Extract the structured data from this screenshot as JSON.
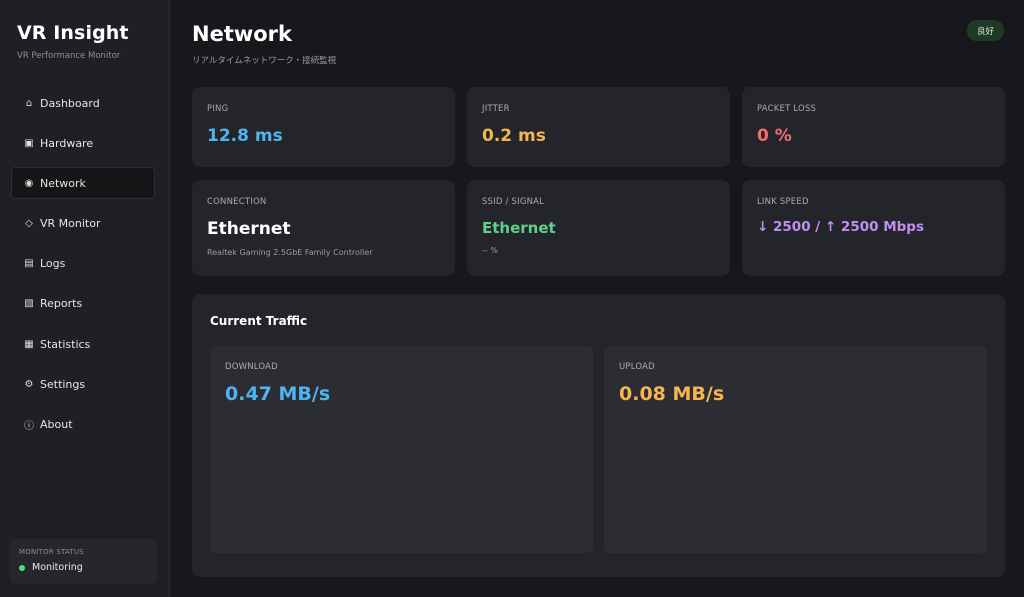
{
  "sidebar": {
    "brand_title": "VR Insight",
    "brand_subtitle": "VR Performance Monitor",
    "items": [
      {
        "label": "Dashboard",
        "icon": "⌂",
        "icon_name": "home-icon"
      },
      {
        "label": "Hardware",
        "icon": "▣",
        "icon_name": "chip-icon"
      },
      {
        "label": "Network",
        "icon": "◉",
        "icon_name": "network-icon",
        "active": true
      },
      {
        "label": "VR Monitor",
        "icon": "◇",
        "icon_name": "vr-icon"
      },
      {
        "label": "Logs",
        "icon": "▤",
        "icon_name": "logs-icon"
      },
      {
        "label": "Reports",
        "icon": "▧",
        "icon_name": "reports-icon"
      },
      {
        "label": "Statistics",
        "icon": "▦",
        "icon_name": "statistics-icon"
      },
      {
        "label": "Settings",
        "icon": "⚙",
        "icon_name": "gear-icon"
      },
      {
        "label": "About",
        "icon": "ⓘ",
        "icon_name": "info-icon"
      }
    ],
    "monitor_status": {
      "label": "MONITOR STATUS",
      "value": "Monitoring",
      "dot_color": "#4ade80"
    }
  },
  "header": {
    "title": "Network",
    "subtitle": "リアルタイムネットワーク・接続監視",
    "status_badge": "良好"
  },
  "metrics": {
    "ping": {
      "label": "PING",
      "value": "12.8 ms",
      "color": "#4fb4f0"
    },
    "jitter": {
      "label": "JITTER",
      "value": "0.2 ms",
      "color": "#f4b650"
    },
    "packet_loss": {
      "label": "PACKET LOSS",
      "value": "0 %",
      "color": "#f26d6d"
    },
    "connection": {
      "label": "CONNECTION",
      "value": "Ethernet",
      "detail": "Realtek Gaming 2.5GbE Family Controller"
    },
    "ssid": {
      "label": "SSID / SIGNAL",
      "value": "Ethernet",
      "detail": "-- %",
      "color": "#5fd08a"
    },
    "link_speed": {
      "label": "LINK SPEED",
      "value": "↓ 2500 / ↑ 2500 Mbps",
      "color": "#c18ef2"
    }
  },
  "traffic": {
    "title": "Current Traffic",
    "download": {
      "label": "DOWNLOAD",
      "value": "0.47 MB/s",
      "color": "#4fb4f0"
    },
    "upload": {
      "label": "UPLOAD",
      "value": "0.08 MB/s",
      "color": "#f4b650"
    }
  }
}
